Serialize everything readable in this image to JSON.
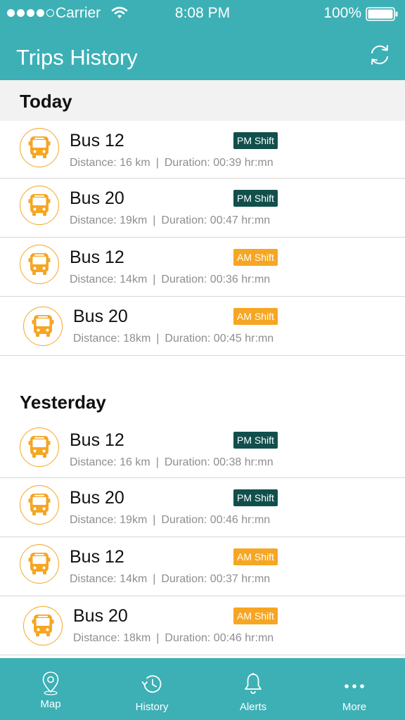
{
  "status_bar": {
    "carrier": "Carrier",
    "time": "8:08 PM",
    "battery": "100%"
  },
  "header": {
    "title": "Trips History",
    "refresh_icon": "refresh-icon"
  },
  "sections": [
    {
      "title": "Today",
      "trips": [
        {
          "bus": "Bus 12",
          "distance": "Distance: 16 km",
          "duration": "Duration: 00:39 hr:mn",
          "shift": "PM Shift"
        },
        {
          "bus": "Bus 20",
          "distance": "Distance: 19km",
          "duration": "Duration: 00:47 hr:mn",
          "shift": "PM Shift"
        },
        {
          "bus": "Bus 12",
          "distance": "Distance: 14km",
          "duration": "Duration: 00:36 hr:mn",
          "shift": "AM Shift"
        },
        {
          "bus": "Bus 20",
          "distance": "Distance: 18km",
          "duration": "Duration: 00:45 hr:mn",
          "shift": "AM Shift"
        }
      ]
    },
    {
      "title": "Yesterday",
      "trips": [
        {
          "bus": "Bus 12",
          "distance": "Distance: 16 km",
          "duration": "Duration: 00:38 hr:mn",
          "shift": "PM Shift"
        },
        {
          "bus": "Bus 20",
          "distance": "Distance: 19km",
          "duration": "Duration: 00:46 hr:mn",
          "shift": "PM Shift"
        },
        {
          "bus": "Bus 12",
          "distance": "Distance: 14km",
          "duration": "Duration: 00:37 hr:mn",
          "shift": "AM Shift"
        },
        {
          "bus": "Bus 20",
          "distance": "Distance: 18km",
          "duration": "Duration: 00:46 hr:mn",
          "shift": "AM Shift"
        }
      ]
    }
  ],
  "separator": "|",
  "tabs": [
    {
      "label": "Map",
      "icon": "map-pin-icon"
    },
    {
      "label": "History",
      "icon": "history-icon"
    },
    {
      "label": "Alerts",
      "icon": "bell-icon"
    },
    {
      "label": "More",
      "icon": "more-icon"
    }
  ],
  "colors": {
    "accent": "#3cb0b5",
    "pm_badge": "#114f4c",
    "am_badge": "#f6a623",
    "bus_icon": "#f6a623"
  }
}
